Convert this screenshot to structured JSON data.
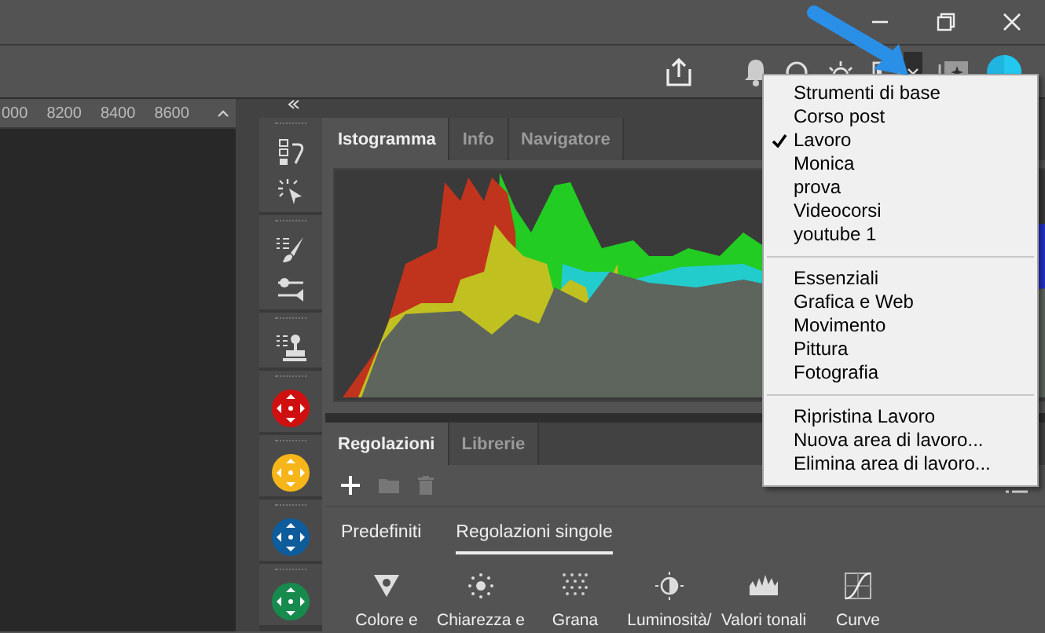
{
  "ruler": {
    "ticks": [
      "000",
      "8200",
      "8400",
      "8600"
    ]
  },
  "histogram_panel": {
    "tabs": [
      {
        "label": "Istogramma",
        "selected": true
      },
      {
        "label": "Info",
        "selected": false
      },
      {
        "label": "Navigatore",
        "selected": false
      }
    ]
  },
  "adjustments_panel": {
    "tabs": [
      {
        "label": "Regolazioni",
        "selected": true
      },
      {
        "label": "Librerie",
        "selected": false
      }
    ],
    "subtabs": [
      {
        "label": "Predefiniti",
        "selected": false
      },
      {
        "label": "Regolazioni singole",
        "selected": true
      }
    ],
    "items": [
      {
        "label": "Colore e"
      },
      {
        "label": "Chiarezza e"
      },
      {
        "label": "Grana"
      },
      {
        "label": "Luminosità/"
      },
      {
        "label": "Valori tonali"
      },
      {
        "label": "Curve"
      }
    ]
  },
  "workspace_menu": {
    "groups": [
      {
        "items": [
          {
            "label": "Strumenti di base",
            "checked": false
          },
          {
            "label": "Corso post",
            "checked": false
          },
          {
            "label": "Lavoro",
            "checked": true
          },
          {
            "label": "Monica",
            "checked": false
          },
          {
            "label": "prova",
            "checked": false
          },
          {
            "label": "Videocorsi",
            "checked": false
          },
          {
            "label": "youtube 1",
            "checked": false
          }
        ]
      },
      {
        "items": [
          {
            "label": "Essenziali",
            "checked": false
          },
          {
            "label": "Grafica e Web",
            "checked": false
          },
          {
            "label": "Movimento",
            "checked": false
          },
          {
            "label": "Pittura",
            "checked": false
          },
          {
            "label": "Fotografia",
            "checked": false
          }
        ]
      },
      {
        "items": [
          {
            "label": "Ripristina Lavoro",
            "checked": false
          },
          {
            "label": "Nuova area di lavoro...",
            "checked": false
          },
          {
            "label": "Elimina area di lavoro...",
            "checked": false
          }
        ]
      }
    ]
  }
}
